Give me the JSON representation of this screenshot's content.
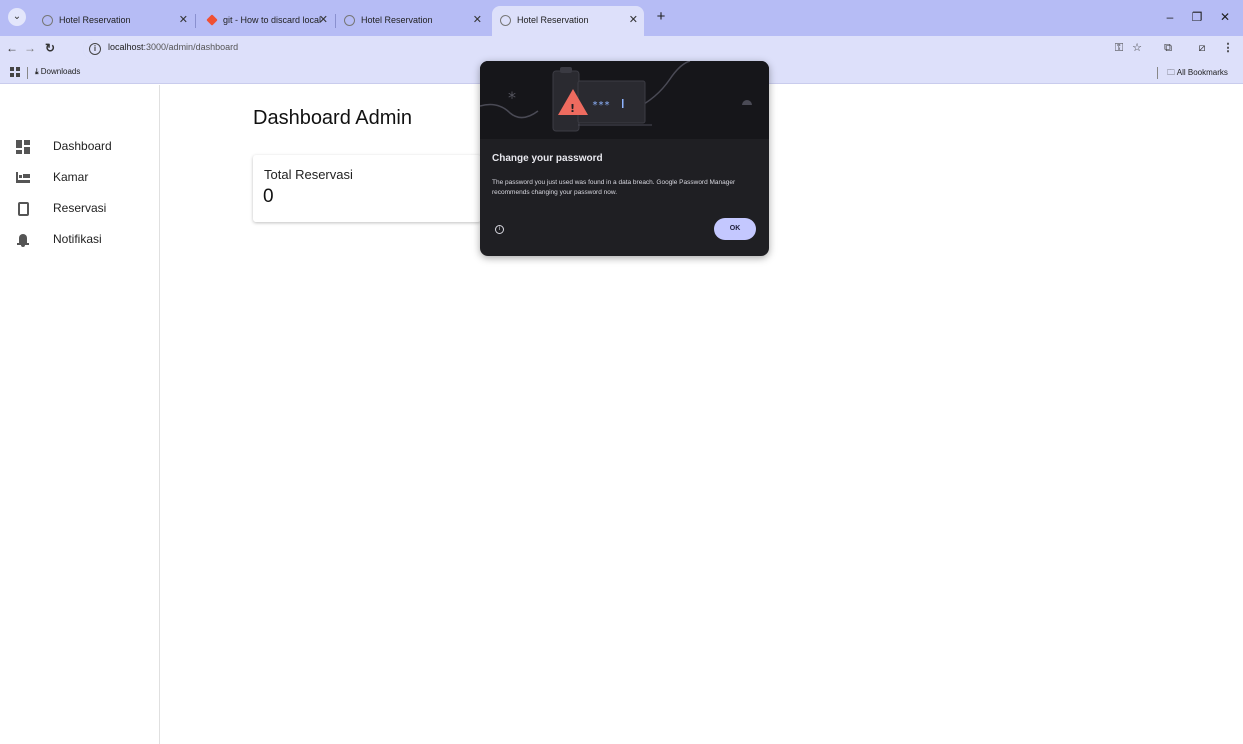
{
  "tabs": [
    {
      "title": "Hotel Reservation",
      "active": false,
      "favicon": "globe-icon"
    },
    {
      "title": "git - How to discard local chang",
      "active": false,
      "favicon": "git-icon"
    },
    {
      "title": "Hotel Reservation",
      "active": false,
      "favicon": "globe-icon"
    },
    {
      "title": "Hotel Reservation",
      "active": true,
      "favicon": "globe-icon"
    }
  ],
  "address_bar": {
    "url_host": "localhost",
    "url_rest": ":3000/admin/dashboard"
  },
  "bookmarks": {
    "downloads_label": "Downloads",
    "all_bookmarks_label": "All Bookmarks"
  },
  "sidebar": {
    "items": [
      {
        "label": "Dashboard",
        "icon": "dashboard-icon"
      },
      {
        "label": "Kamar",
        "icon": "bed-icon"
      },
      {
        "label": "Reservasi",
        "icon": "receipt-icon"
      },
      {
        "label": "Notifikasi",
        "icon": "bell-icon"
      }
    ]
  },
  "main": {
    "title": "Dashboard Admin",
    "card": {
      "label": "Total Reservasi",
      "value": "0"
    }
  },
  "password_bubble": {
    "title": "Change your password",
    "body": "The password you just used was found in a data breach. Google Password Manager recommends changing your password now.",
    "ok_label": "OK",
    "masked_text": "***"
  },
  "colors": {
    "tabstrip_bg": "#b6bcf5",
    "toolbar_bg": "#dde0fa",
    "bubble_bg": "#1f1f23",
    "ok_button": "#c4c8ff",
    "warning": "#ee6b5f"
  }
}
